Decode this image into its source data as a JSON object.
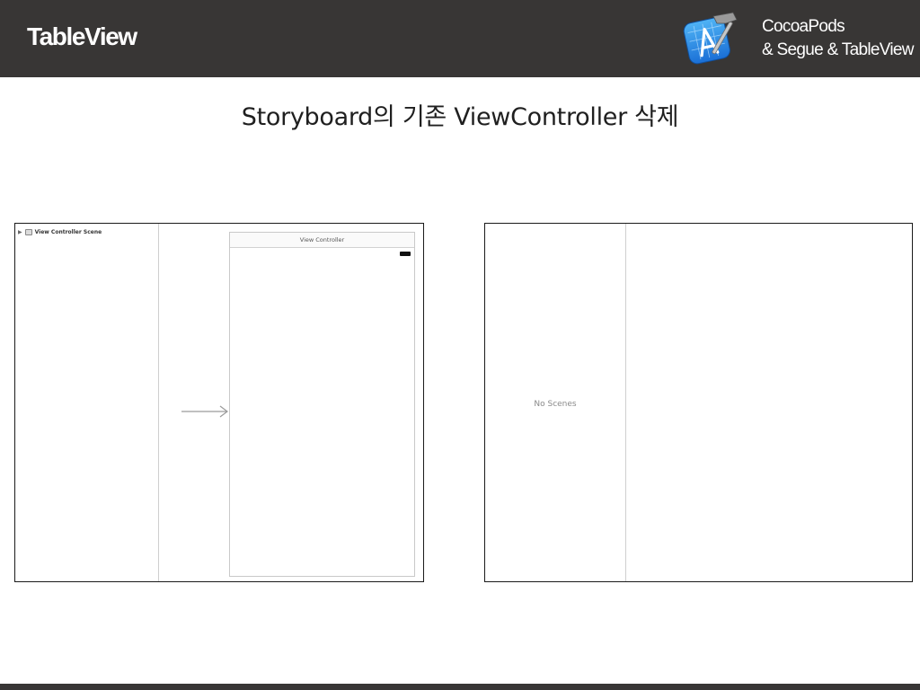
{
  "header": {
    "title": "TableView",
    "subtitle_line1": "CocoaPods",
    "subtitle_line2": "& Segue & TableView",
    "icon": "xcode-icon",
    "background": "#383635"
  },
  "slide": {
    "title": "Storyboard의 기존 ViewController 삭제"
  },
  "left_screenshot": {
    "outline_item": "View Controller Scene",
    "outline_icons": [
      "disclosure-triangle-icon",
      "scene-icon"
    ],
    "canvas_vc_title": "View Controller",
    "entry_point_icon": "entry-arrow-icon"
  },
  "right_screenshot": {
    "empty_message": "No Scenes"
  }
}
